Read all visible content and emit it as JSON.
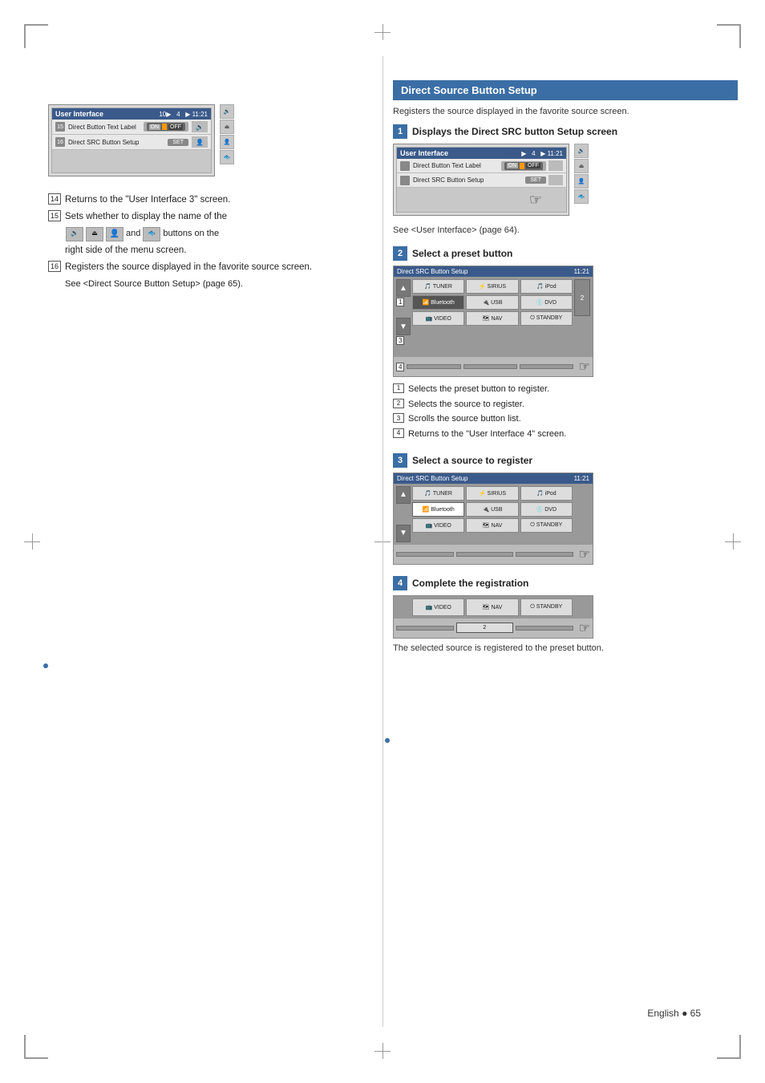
{
  "page": {
    "page_number": "English ● 65"
  },
  "left": {
    "ui_title": "User Interface",
    "ui_num": "10",
    "ui_pos": "4",
    "ui_time": "11:21",
    "row15_label": "Direct Button Text Label",
    "row16_label": "Direct SRC Button Setup",
    "items": [
      {
        "num": "14",
        "text": "Returns to the \"User Interface 3\" screen."
      },
      {
        "num": "15",
        "text": "Sets whether to display the name of the"
      },
      {
        "num": "15b",
        "text": "and      buttons on the right side of the menu screen."
      },
      {
        "num": "16",
        "text": "Registers the source displayed in the favorite source screen."
      }
    ],
    "see_text": "See <Direct Source Button Setup> (page 65)."
  },
  "right": {
    "section_title": "Direct Source Button Setup",
    "intro_text": "Registers the source displayed in the favorite source screen.",
    "steps": [
      {
        "num": "1",
        "title": "Displays the Direct SRC button Setup screen",
        "see_text": "See <User Interface> (page 64).",
        "ui_title": "User Interface",
        "ui_row1": "Direct Button Text Label",
        "ui_row2": "Direct SRC Button Setup"
      },
      {
        "num": "2",
        "title": "Select a preset button",
        "annotations": [
          {
            "num": "1",
            "text": "Selects the preset button to register."
          },
          {
            "num": "2",
            "text": "Selects the source to register."
          },
          {
            "num": "3",
            "text": "Scrolls the source button list."
          },
          {
            "num": "4",
            "text": "Returns to the \"User Interface 4\" screen."
          }
        ]
      },
      {
        "num": "3",
        "title": "Select a source to register"
      },
      {
        "num": "4",
        "title": "Complete the registration",
        "result_text": "The selected source is registered to the preset button."
      }
    ],
    "src_buttons": {
      "title": "Direct SRC Button Setup",
      "time": "11:21",
      "buttons": [
        "TUNER",
        "SIRIUS",
        "iPod",
        "Bluetooth",
        "USB",
        "DVD",
        "VIDEO",
        "NAV",
        "STANDBY"
      ]
    }
  }
}
